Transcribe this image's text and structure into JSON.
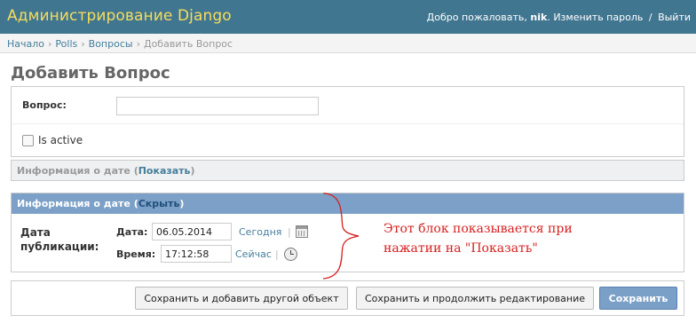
{
  "header": {
    "branding": "Администрирование Django",
    "welcome": "Добро пожаловать,",
    "username": "nik",
    "change_password": "Изменить пароль",
    "separator": "/",
    "logout": "Выйти"
  },
  "breadcrumbs": [
    {
      "label": "Начало",
      "link": true
    },
    {
      "label": "Polls",
      "link": true
    },
    {
      "label": "Вопросы",
      "link": true
    },
    {
      "label": "Добавить Вопрос",
      "link": false
    }
  ],
  "page_title": "Добавить Вопрос",
  "form": {
    "question_label": "Вопрос:",
    "question_value": "",
    "is_active_label": "Is active",
    "is_active_checked": false
  },
  "collapsed_fieldset": {
    "title": "Информация о дате",
    "toggle": "Показать"
  },
  "expanded_fieldset": {
    "title": "Информация о дате",
    "toggle": "Скрыть",
    "pub_label_line1": "Дата",
    "pub_label_line2": "публикации:",
    "date_label": "Дата:",
    "date_value": "06.05.2014",
    "today_link": "Сегодня",
    "time_label": "Время:",
    "time_value": "17:12:58",
    "now_link": "Сейчас",
    "calendar_icon": "calendar-icon",
    "clock_icon": "clock-icon"
  },
  "annotation": {
    "line1": "Этот блок показывается при",
    "line2": "нажатии на \"Показать\"",
    "color": "#d62020"
  },
  "buttons": {
    "save_add_another": "Сохранить и добавить другой объект",
    "save_continue": "Сохранить и продолжить редактирование",
    "save": "Сохранить"
  },
  "colors": {
    "header_bg": "#417690",
    "branding": "#f5dd5d",
    "link": "#447e9b",
    "fieldset_head": "#7ca0c7"
  }
}
